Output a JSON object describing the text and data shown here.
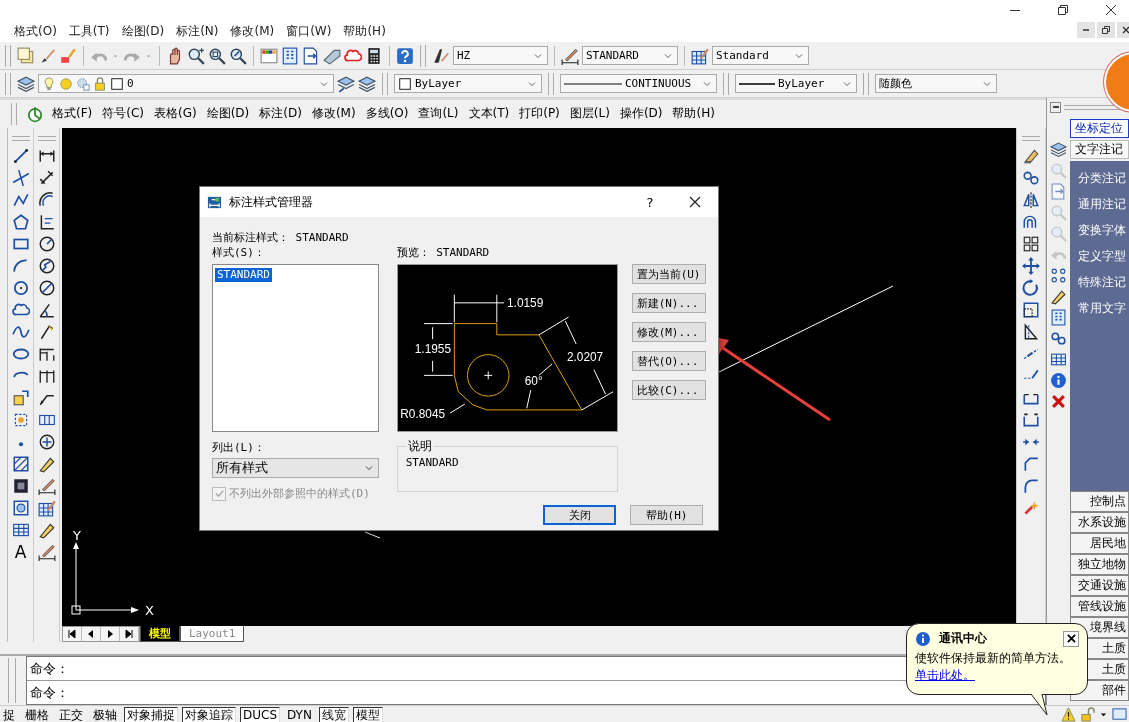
{
  "menu_bar": [
    "格式(O)",
    "工具(T)",
    "绘图(D)",
    "标注(N)",
    "修改(M)",
    "窗口(W)",
    "帮助(H)"
  ],
  "style_toolbar": {
    "text_style": "HZ",
    "dimension_style": "STANDARD",
    "table_style": "Standard"
  },
  "layer_toolbar": {
    "layer": "0",
    "color_setting": "ByLayer",
    "linetype": "CONTINUOUS",
    "lineweight": "ByLayer",
    "plot_style": "随颜色"
  },
  "menu_bar_2": [
    "格式(F)",
    "符号(C)",
    "表格(G)",
    "绘图(D)",
    "标注(D)",
    "修改(M)",
    "多线(O)",
    "查询(L)",
    "文本(T)",
    "打印(P)",
    "图层(L)",
    "操作(D)",
    "帮助(H)"
  ],
  "draw_toolbar_glyph": "A",
  "canvas": {
    "ucs": {
      "x_label": "X",
      "y_label": "Y"
    }
  },
  "layout_tabs": [
    {
      "label": "模型",
      "selected": true
    },
    {
      "label": "Layout1",
      "selected": false
    }
  ],
  "command_lines": [
    "命令：",
    "命令："
  ],
  "status_toggles": [
    {
      "label": "捉",
      "on": false
    },
    {
      "label": "栅格",
      "on": false
    },
    {
      "label": "正交",
      "on": false
    },
    {
      "label": "极轴",
      "on": false
    },
    {
      "label": "对象捕捉",
      "on": true
    },
    {
      "label": "对象追踪",
      "on": true
    },
    {
      "label": "DUCS",
      "on": true
    },
    {
      "label": "DYN",
      "on": false
    },
    {
      "label": "线宽",
      "on": true
    },
    {
      "label": "模型",
      "on": true
    }
  ],
  "dialog": {
    "title": "标注样式管理器",
    "help_glyph": "?",
    "current_style": "当前标注样式： STANDARD",
    "styles_label": "样式(S)：",
    "styles": [
      {
        "name": "STANDARD",
        "selected": true
      }
    ],
    "preview_label": "预览： STANDARD",
    "preview_labels": [
      "1.0159",
      "1.1955",
      "2.0207",
      "60°",
      "R0.8045"
    ],
    "buttons": [
      "置为当前(U)",
      "新建(N)...",
      "修改(M)...",
      "替代(O)...",
      "比较(C)..."
    ],
    "list_label": "列出(L)：",
    "list_value": "所有样式",
    "exclude_xref": {
      "label": "不列出外部参照中的样式(D)",
      "checked": true,
      "disabled": true
    },
    "description_label": "说明",
    "description": "STANDARD",
    "footer_buttons": [
      {
        "label": "关闭",
        "default": true
      },
      {
        "label": "帮助(H)",
        "default": false
      }
    ]
  },
  "right_panel": {
    "tabs": [
      {
        "label": "坐标定位",
        "selected": true
      },
      {
        "label": "文字注记",
        "selected": false
      }
    ],
    "items": [
      "分类注记",
      "通用注记",
      "变换字体",
      "定义字型",
      "特殊注记",
      "常用文字"
    ],
    "categories": [
      "控制点",
      "水系设施",
      "居民地",
      "独立地物",
      "交通设施",
      "管线设施",
      "境界线",
      "土质",
      "土质",
      "部件"
    ]
  },
  "notification": {
    "title": "通讯中心",
    "message": "使软件保持最新的简单方法。",
    "link": "单击此处。"
  }
}
